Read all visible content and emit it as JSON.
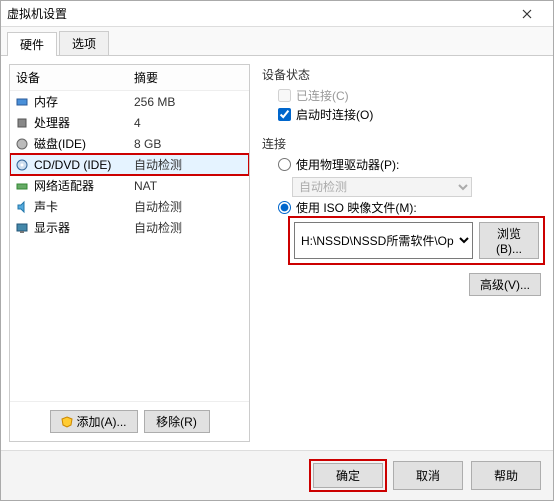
{
  "window": {
    "title": "虚拟机设置"
  },
  "tabs": {
    "hardware": "硬件",
    "options": "选项"
  },
  "hw": {
    "col_device": "设备",
    "col_summary": "摘要",
    "items": [
      {
        "label": "内存",
        "summary": "256 MB"
      },
      {
        "label": "处理器",
        "summary": "4"
      },
      {
        "label": "磁盘(IDE)",
        "summary": "8 GB"
      },
      {
        "label": "CD/DVD (IDE)",
        "summary": "自动检测"
      },
      {
        "label": "网络适配器",
        "summary": "NAT"
      },
      {
        "label": "声卡",
        "summary": "自动检测"
      },
      {
        "label": "显示器",
        "summary": "自动检测"
      }
    ],
    "add": "添加(A)...",
    "remove": "移除(R)"
  },
  "right": {
    "status_title": "设备状态",
    "connected": "已连接(C)",
    "connect_on": "启动时连接(O)",
    "conn_title": "连接",
    "use_phys": "使用物理驱动器(P):",
    "phys_auto": "自动检测",
    "use_iso": "使用 ISO 映像文件(M):",
    "iso_path": "H:\\NSSD\\NSSD所需软件\\Op",
    "browse": "浏览(B)...",
    "advanced": "高级(V)..."
  },
  "footer": {
    "ok": "确定",
    "cancel": "取消",
    "help": "帮助"
  }
}
